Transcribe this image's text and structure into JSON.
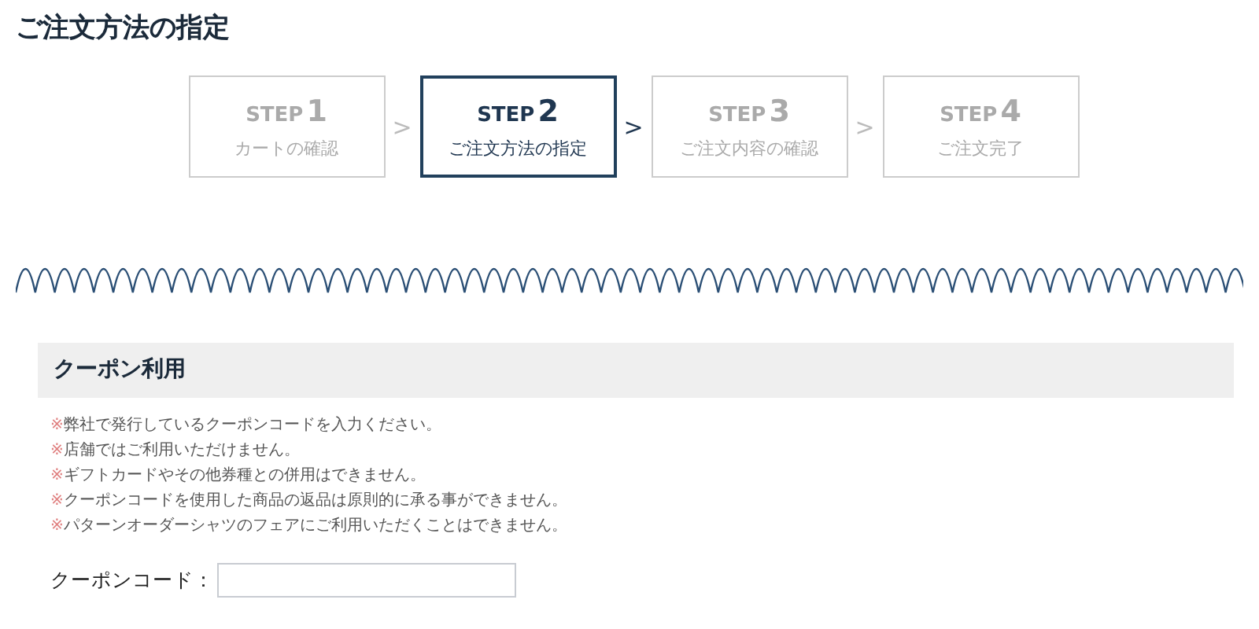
{
  "page_title": "ご注文方法の指定",
  "steps": [
    {
      "label": "STEP",
      "number": "1",
      "name": "カートの確認",
      "selected": false
    },
    {
      "label": "STEP",
      "number": "2",
      "name": "ご注文方法の指定",
      "selected": true
    },
    {
      "label": "STEP",
      "number": "3",
      "name": "ご注文内容の確認",
      "selected": false
    },
    {
      "label": "STEP",
      "number": "4",
      "name": "ご注文完了",
      "selected": false
    }
  ],
  "step_separators": [
    ">",
    ">",
    ">"
  ],
  "coupon": {
    "title": "クーポン利用",
    "notes": [
      {
        "mark": "※",
        "text": "弊社で発行しているクーポンコードを入力ください。"
      },
      {
        "mark": "※",
        "text": "店舗ではご利用いただけません。"
      },
      {
        "mark": "※",
        "text": "ギフトカードやその他券種との併用はできません。"
      },
      {
        "mark": "※",
        "text": "クーポンコードを使用した商品の返品は原則的に承る事ができません。"
      },
      {
        "mark": "※",
        "text": "パターンオーダーシャツのフェアにご利用いただくことはできません。"
      }
    ],
    "field_label": "クーポンコード："
  }
}
